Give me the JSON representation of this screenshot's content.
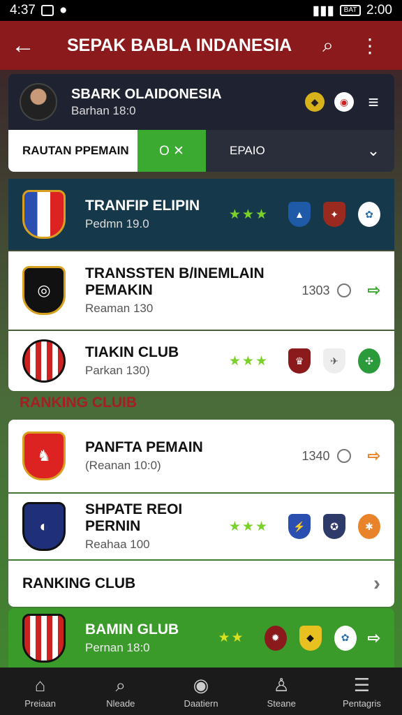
{
  "status": {
    "left_time": "4:37",
    "right_time": "2:00",
    "battery": "BAT"
  },
  "appbar": {
    "back_icon": "arrow-left-icon",
    "title": "SEPAK BABLA INDANESIA"
  },
  "profile": {
    "name": "SBARK OLAIDONESIA",
    "subtitle": "Barhan 18:0"
  },
  "tabs": {
    "tab1": "RAUTAN PPEMAIN",
    "tab2": "O ✕",
    "tab3": "EPAIO",
    "chevron": "⌄"
  },
  "items": [
    {
      "name": "TRANFIP ELIPIN",
      "sub": "Pedmn 19.0",
      "stars": "★★★",
      "colors": [
        "#e23b3b",
        "#1f5aa8",
        "#9a2a20",
        "#2a6fb0"
      ]
    },
    {
      "name": "TRANSSTEN B/INEMLAIN PEMAKIN",
      "sub": "Reaman 130",
      "num": "1303",
      "arrow": "⇨"
    },
    {
      "name": "TIAKIN CLUB",
      "sub": "Parkan 130)",
      "stars": "★★★",
      "colors": [
        "#8b1a1d",
        "#6a6a6a",
        "#2a9a3a"
      ]
    },
    {
      "name": "PANFTA PEMAIN",
      "sub": "(Reanan 10:0)",
      "num": "1340",
      "arrow": "⇨"
    },
    {
      "name": "SHPATE REOI PERNIN",
      "sub": "Reahaa 100",
      "stars": "★★★",
      "colors": [
        "#2a4fb0",
        "#2d3a6a",
        "#e8832a"
      ]
    },
    {
      "name": "RANKING CLUB",
      "arrow": "›"
    },
    {
      "name": "BAMIN GLUB",
      "sub": "Pernan 18:0",
      "stars": "★★",
      "arrow": "⇨"
    }
  ],
  "section_label": "RANKING CLUIB",
  "nav": [
    {
      "label": "Preiaan",
      "icon": "home-icon"
    },
    {
      "label": "Nleade",
      "icon": "search-icon"
    },
    {
      "label": "Daatiern",
      "icon": "ball-icon"
    },
    {
      "label": "Steane",
      "icon": "profile-icon"
    },
    {
      "label": "Pentagris",
      "icon": "list-icon"
    }
  ]
}
